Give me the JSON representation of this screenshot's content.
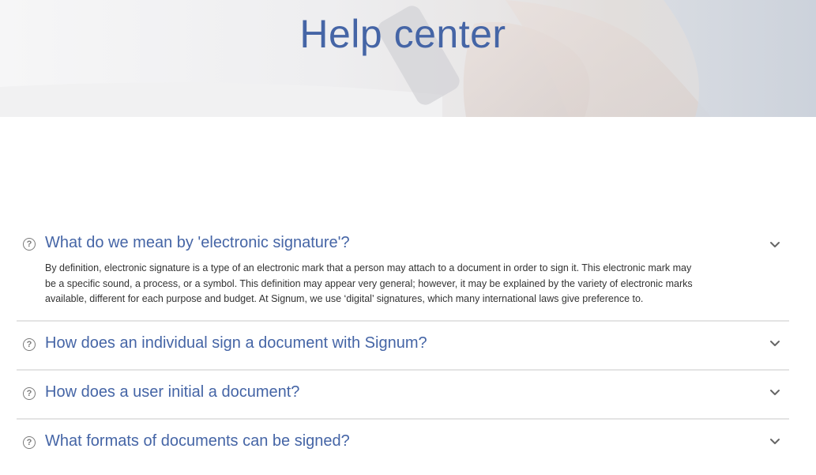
{
  "hero": {
    "title": "Help center"
  },
  "faq": {
    "items": [
      {
        "question": "What do we mean by 'electronic signature'?",
        "answer": "By definition, electronic signature is a type of an electronic mark that a person may attach to a document in order to sign it. This electronic mark may be a specific sound, a process, or a symbol. This definition may appear very general; however, it may be explained by the variety of electronic marks available, different for each purpose and budget. At Signum, we use ‘digital’ signatures, which many international laws give preference to.",
        "expanded": true
      },
      {
        "question": "How does an individual sign a document with Signum?",
        "expanded": false
      },
      {
        "question": "How does a user initial a document?",
        "expanded": false
      },
      {
        "question": "What formats of documents can be signed?",
        "expanded": false
      }
    ],
    "question_icon": "?"
  },
  "colors": {
    "accent": "#4565a6",
    "divider": "#e4e4e4",
    "body_text": "#333333"
  }
}
